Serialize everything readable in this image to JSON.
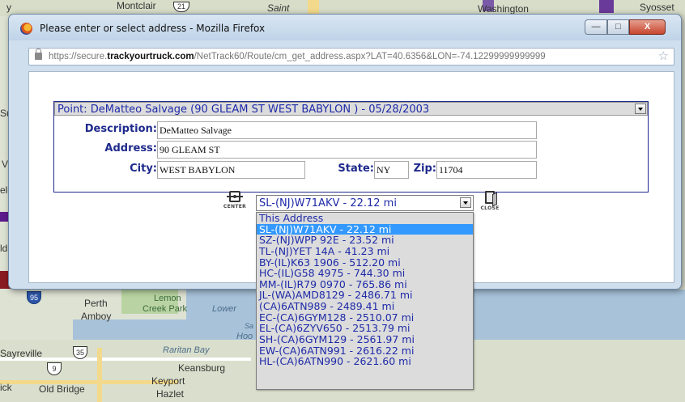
{
  "map": {
    "labels": {
      "montclair": "Montclair",
      "saint": "Saint",
      "washington": "Washington",
      "syosset": "Syosset",
      "perth_amboy_1": "Perth",
      "perth_amboy_2": "Amboy",
      "lemon_creek_1": "Lemon",
      "lemon_creek_2": "Creek Park",
      "lower": "Lower",
      "raritan_bay": "Raritan Bay",
      "sayreville": "Sayreville",
      "keansburg": "Keansburg",
      "keyport": "Keyport",
      "old_bridge": "Old Bridge",
      "hazlet": "Hazlet",
      "hoo": "Hoo",
      "sa": "Sa",
      "edge_y": "y",
      "edge_su": "Su",
      "edge_v": "V",
      "edge_eld": "eld",
      "edge_ld": "ld",
      "edge_ick": "ick"
    },
    "shields": {
      "s21": "21",
      "s95": "95",
      "s35": "35",
      "s9": "9"
    }
  },
  "window": {
    "title": "Please enter or select address - Mozilla Firefox",
    "buttons": {
      "minimize": "—",
      "maximize": "□",
      "close": "X"
    },
    "url_prefix": "https://secure.",
    "url_domain": "trackyourtruck.com",
    "url_path": "/NetTrack60/Route/cm_get_address.aspx?LAT=40.6356&LON=-74.12299999999999"
  },
  "form": {
    "point_select": "Point: DeMatteo Salvage (90 GLEAM ST WEST BABYLON ) - 05/28/2003",
    "description_label": "Description:",
    "description_value": "DeMatteo Salvage",
    "address_label": "Address:",
    "address_value": "90 GLEAM ST",
    "city_label": "City:",
    "city_value": "WEST BABYLON",
    "state_label": "State:",
    "state_value": "NY",
    "zip_label": "Zip:",
    "zip_value": "11704"
  },
  "controls": {
    "center_label": "CENTER",
    "close_label": "CLOSE",
    "unit_select": "SL-(NJ)W71AKV - 22.12 mi",
    "options": [
      "This Address",
      "SL-(NJ)W71AKV - 22.12 mi",
      "SZ-(NJ)WPP 92E - 23.52 mi",
      "TL-(NJ)YET 14A - 41.23 mi",
      "BY-(IL)K63 1906 - 512.20 mi",
      "HC-(IL)G58 4975 - 744.30 mi",
      "MM-(IL)R79 0970 - 765.86 mi",
      "JL-(WA)AMD8129 - 2486.71 mi",
      "(CA)6ATN989 - 2489.41 mi",
      "EC-(CA)6GYM128 - 2510.07 mi",
      "EL-(CA)6ZYV650 - 2513.79 mi",
      "SH-(CA)6GYM129 - 2561.97 mi",
      "EW-(CA)6ATN991 - 2616.22 mi",
      "HL-(CA)6ATN990 - 2621.60 mi"
    ],
    "selected_index": 1
  },
  "colors": {
    "label_blue": "#1e2a8c",
    "option_blue": "#1e2aa8",
    "selection": "#3399ff"
  }
}
